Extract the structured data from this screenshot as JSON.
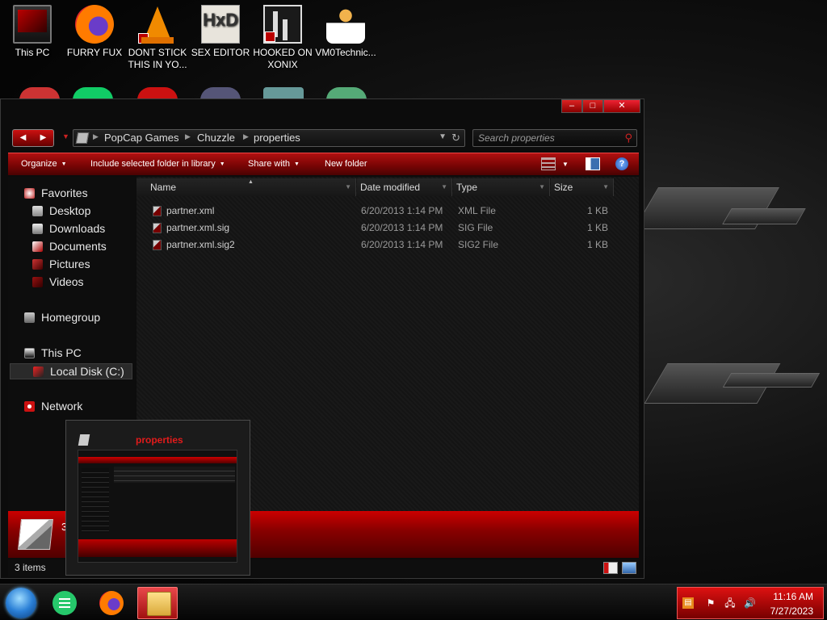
{
  "desktop": {
    "icons": [
      {
        "label": "This PC",
        "icon": "monitor-icon"
      },
      {
        "label": "FURRY FUX",
        "icon": "firefox-icon"
      },
      {
        "label": "DONT STICK THIS IN YO...",
        "icon": "vlc-cone-icon"
      },
      {
        "label": "SEX EDITOR",
        "icon": "hxd-icon"
      },
      {
        "label": "HOOKED ON XONIX",
        "icon": "maze-game-icon"
      },
      {
        "label": "VM0Technic...",
        "icon": "doctor-icon"
      }
    ]
  },
  "window": {
    "caption": {
      "minimize": "–",
      "maximize": "□",
      "close": "✕"
    },
    "nav": {
      "back": "◀",
      "forward": "▶",
      "recent": "▼"
    },
    "breadcrumb": [
      "PopCap Games",
      "Chuzzle",
      "properties"
    ],
    "breadcrumb_sep": "▶",
    "search_placeholder": "Search properties",
    "toolbar": {
      "organize": "Organize",
      "include_in_library": "Include selected folder in library",
      "share_with": "Share with",
      "new_folder": "New folder",
      "dropdown_glyph": "▼",
      "help_glyph": "?"
    },
    "nav_pane": {
      "favorites": "Favorites",
      "favorites_items": [
        "Desktop",
        "Downloads",
        "Documents",
        "Pictures",
        "Videos"
      ],
      "homegroup": "Homegroup",
      "this_pc": "This PC",
      "local_disk": "Local Disk (C:)",
      "network": "Network"
    },
    "columns": [
      "Name",
      "Date modified",
      "Type",
      "Size"
    ],
    "files": [
      {
        "name": "partner.xml",
        "date": "6/20/2013 1:14 PM",
        "type": "XML File",
        "size": "1 KB"
      },
      {
        "name": "partner.xml.sig",
        "date": "6/20/2013 1:14 PM",
        "type": "SIG File",
        "size": "1 KB"
      },
      {
        "name": "partner.xml.sig2",
        "date": "6/20/2013 1:14 PM",
        "type": "SIG2 File",
        "size": "1 KB"
      }
    ],
    "details_pane": {
      "text": "3"
    },
    "status": {
      "item_count": "3 items"
    }
  },
  "thumbnail": {
    "title": "properties"
  },
  "taskbar": {
    "apps": [
      "start-orb",
      "notes-app",
      "firefox",
      "file-explorer"
    ],
    "tray": {
      "flag": "⚑",
      "network": "🖧",
      "volume": "🔊",
      "time": "11:16 AM",
      "date": "7/27/2023"
    }
  },
  "colors": {
    "accent": "#b01010",
    "accent_dark": "#4a0202",
    "window_bg": "#0c0c0c"
  }
}
